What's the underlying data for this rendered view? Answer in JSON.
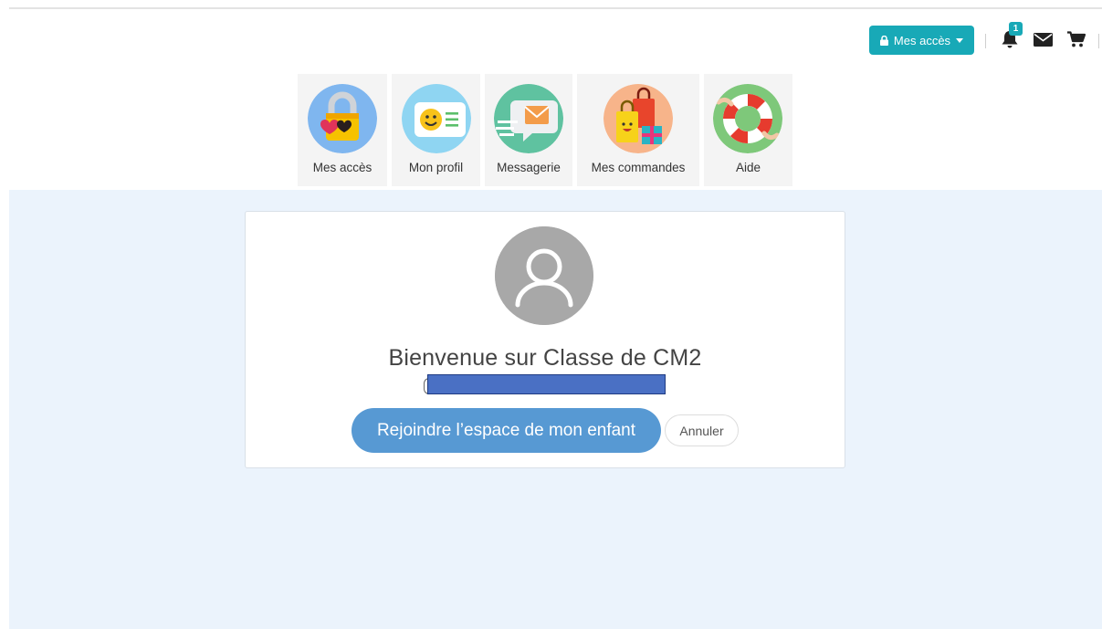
{
  "toolbar": {
    "access_label": "Mes accès",
    "lock_icon": "lock-icon",
    "caret_icon": "caret-down-icon",
    "notification_count": "1",
    "notification_icon": "bell-icon",
    "mail_icon": "envelope-icon",
    "cart_icon": "cart-icon",
    "accent_color": "#18a9b7"
  },
  "shortcuts": [
    {
      "label": "Mes accès",
      "icon": "padlock-hearts-icon"
    },
    {
      "label": "Mon profil",
      "icon": "profile-card-icon"
    },
    {
      "label": "Messagerie",
      "icon": "speech-bubble-envelope-icon"
    },
    {
      "label": "Mes commandes",
      "icon": "shopping-bags-icon"
    },
    {
      "label": "Aide",
      "icon": "lifebuoy-icon"
    }
  ],
  "card": {
    "avatar_icon": "user-avatar-icon",
    "welcome": "Bienvenue sur Classe de CM2",
    "join_label": "Rejoindre l’espace de mon enfant",
    "cancel_label": "Annuler",
    "join_color": "#5799d3"
  },
  "background_color": "#ebf3fc"
}
